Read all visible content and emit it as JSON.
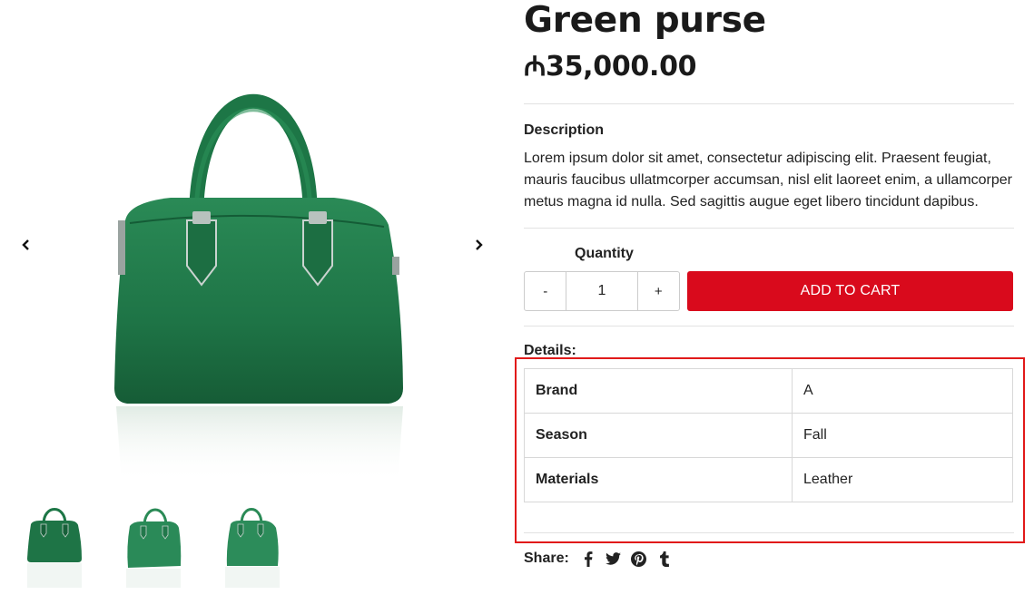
{
  "product": {
    "title": "Green purse",
    "price": "₼35,000.00",
    "image_alt": "green-leather-handbag"
  },
  "gallery": {
    "prev_icon": "chevron-left-icon",
    "next_icon": "chevron-right-icon",
    "thumbnails": [
      {
        "name": "thumbnail-front"
      },
      {
        "name": "thumbnail-angle-left"
      },
      {
        "name": "thumbnail-angle-right"
      }
    ]
  },
  "description": {
    "heading": "Description",
    "text": "Lorem ipsum dolor sit amet, consectetur adipiscing elit. Praesent feugiat, mauris faucibus ullatmcorper accumsan, nisl elit laoreet enim, a ullamcorper metus magna id nulla. Sed sagittis augue eget libero tincidunt dapibus."
  },
  "cart": {
    "quantity_label": "Quantity",
    "minus_label": "-",
    "quantity_value": "1",
    "plus_label": "+",
    "add_to_cart_label": "ADD TO CART"
  },
  "details": {
    "heading": "Details:",
    "rows": [
      {
        "key": "Brand",
        "value": "A"
      },
      {
        "key": "Season",
        "value": "Fall"
      },
      {
        "key": "Materials",
        "value": "Leather"
      }
    ]
  },
  "share": {
    "label": "Share:",
    "icons": [
      "facebook-icon",
      "twitter-icon",
      "pinterest-icon",
      "tumblr-icon"
    ]
  },
  "colors": {
    "accent": "#d90a1c",
    "highlight_border": "#e11a1a",
    "bag_green": "#1f7a4a"
  }
}
